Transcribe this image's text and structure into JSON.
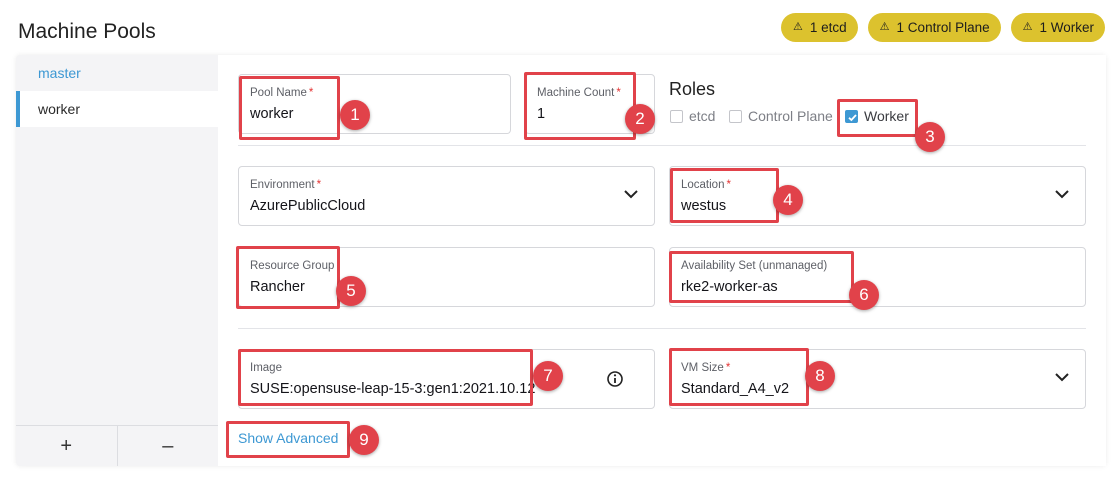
{
  "header": {
    "title": "Machine Pools",
    "badges": [
      "1 etcd",
      "1 Control Plane",
      "1 Worker"
    ],
    "badge_color": "#dcc22e"
  },
  "sidebar": {
    "pools": [
      {
        "label": "master",
        "selected": false
      },
      {
        "label": "worker",
        "selected": true
      }
    ],
    "add_label": "+",
    "remove_label": "–"
  },
  "form": {
    "pool_name": {
      "label": "Pool Name",
      "required": "*",
      "value": "worker"
    },
    "machine_count": {
      "label": "Machine Count",
      "required": "*",
      "value": "1"
    },
    "roles": {
      "title": "Roles",
      "items": [
        {
          "label": "etcd",
          "checked": false
        },
        {
          "label": "Control Plane",
          "checked": false
        },
        {
          "label": "Worker",
          "checked": true
        }
      ]
    },
    "environment": {
      "label": "Environment",
      "required": "*",
      "value": "AzurePublicCloud"
    },
    "location": {
      "label": "Location",
      "required": "*",
      "value": "westus"
    },
    "resource_group": {
      "label": "Resource Group",
      "value": "Rancher"
    },
    "availability_set": {
      "label": "Availability Set (unmanaged)",
      "value": "rke2-worker-as"
    },
    "image": {
      "label": "Image",
      "value": "SUSE:opensuse-leap-15-3:gen1:2021.10.12"
    },
    "vm_size": {
      "label": "VM Size",
      "required": "*",
      "value": "Standard_A4_v2"
    },
    "show_advanced": "Show Advanced"
  },
  "annotations": {
    "numbers": [
      "1",
      "2",
      "3",
      "4",
      "5",
      "6",
      "7",
      "8",
      "9"
    ],
    "color": "#e1424a"
  },
  "icons": {
    "warning": "warning-triangle-icon",
    "dropdown": "chevron-down-icon",
    "info": "info-circle-icon",
    "checkbox": "checkbox-icon"
  }
}
